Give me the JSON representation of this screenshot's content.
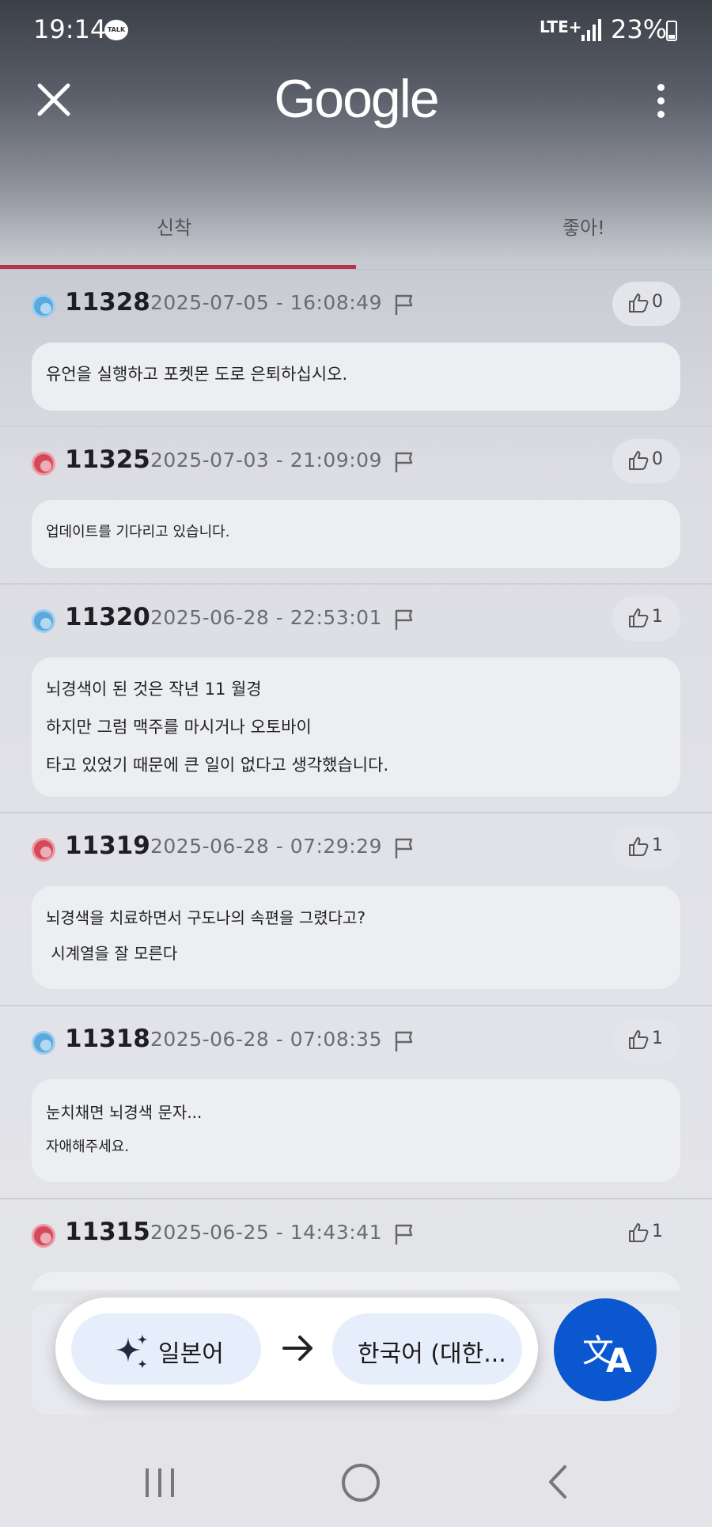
{
  "status_bar": {
    "time": "19:14",
    "talk_badge": "TALK",
    "network": "LTE+",
    "battery": "23%"
  },
  "header": {
    "logo_text": "Google",
    "close_icon": "close-icon",
    "menu_icon": "more-vert-icon"
  },
  "tabs": [
    {
      "label": "신착",
      "active": true
    },
    {
      "label": "좋아!",
      "active": false
    }
  ],
  "comments": [
    {
      "id": "11328",
      "datetime": "2025-07-05 - 16:08:49",
      "likes": "0",
      "avatar_color": "blue",
      "lines": [
        "유언을 실행하고 포켓몬 도로 은퇴하십시오."
      ]
    },
    {
      "id": "11325",
      "datetime": "2025-07-03 - 21:09:09",
      "likes": "0",
      "avatar_color": "red",
      "lines": [
        "업데이트를 기다리고 있습니다."
      ]
    },
    {
      "id": "11320",
      "datetime": "2025-06-28 - 22:53:01",
      "likes": "1",
      "avatar_color": "blue",
      "lines": [
        "뇌경색이 된 것은 작년 11 월경",
        "하지만 그럼 맥주를 마시거나 오토바이",
        "타고 있었기 때문에 큰 일이 없다고 생각했습니다."
      ]
    },
    {
      "id": "11319",
      "datetime": "2025-06-28 - 07:29:29",
      "likes": "1",
      "avatar_color": "red",
      "lines": [
        "뇌경색을 치료하면서 구도나의 속편을 그렸다고?",
        " 시계열을 잘 모른다"
      ]
    },
    {
      "id": "11318",
      "datetime": "2025-06-28 - 07:08:35",
      "likes": "1",
      "avatar_color": "blue",
      "lines": [
        "눈치채면 뇌경색 문자...",
        "자애해주세요."
      ]
    },
    {
      "id": "11315",
      "datetime": "2025-06-25 - 14:43:41",
      "likes": "1",
      "avatar_color": "red",
      "lines": []
    }
  ],
  "translate_bar": {
    "source_lang": "일본어",
    "target_lang": "한국어 (대한...",
    "fab_icon": "translate-icon"
  },
  "colors": {
    "accent": "#b3354d",
    "fab": "#0b57d0",
    "avatar_blue": "#5aa9dd",
    "avatar_red": "#d44a5a"
  }
}
